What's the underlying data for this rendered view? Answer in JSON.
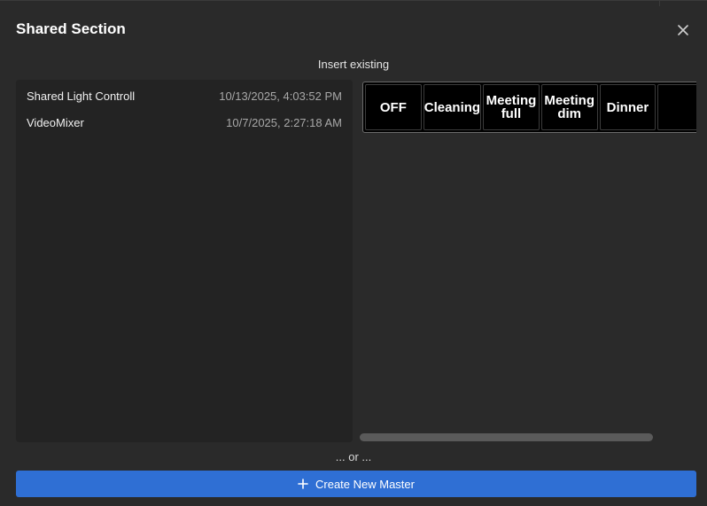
{
  "dialog": {
    "title": "Shared Section",
    "subtitle": "Insert existing",
    "separator": "... or ...",
    "create_label": "Create New Master"
  },
  "masters": [
    {
      "name": "Shared Light Controll",
      "date": "10/13/2025, 4:03:52 PM"
    },
    {
      "name": "VideoMixer",
      "date": "10/7/2025, 2:27:18 AM"
    }
  ],
  "preview_buttons": [
    {
      "line1": "OFF",
      "line2": ""
    },
    {
      "line1": "Cleaning",
      "line2": ""
    },
    {
      "line1": "Meeting",
      "line2": "full"
    },
    {
      "line1": "Meeting",
      "line2": "dim"
    },
    {
      "line1": "Dinner",
      "line2": ""
    },
    {
      "line1": "",
      "line2": ""
    }
  ],
  "colors": {
    "background": "#2a2a2a",
    "panel": "#232323",
    "accent": "#2f6fd4"
  },
  "icons": {
    "close": "close-icon",
    "plus": "plus-icon"
  }
}
